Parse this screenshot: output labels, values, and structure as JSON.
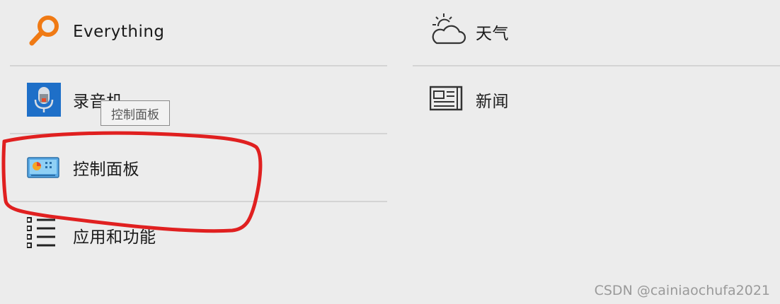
{
  "left_column": {
    "items": [
      {
        "label": "Everything",
        "icon": "everything-search-icon"
      },
      {
        "label": "录音机",
        "icon": "voice-recorder-icon"
      },
      {
        "label": "控制面板",
        "icon": "control-panel-icon"
      },
      {
        "label": "应用和功能",
        "icon": "apps-and-features-icon"
      }
    ]
  },
  "right_column": {
    "items": [
      {
        "label": "天气",
        "icon": "weather-icon"
      },
      {
        "label": "新闻",
        "icon": "news-icon"
      }
    ]
  },
  "tooltip": {
    "text": "控制面板"
  },
  "annotation": {
    "shape": "hand-drawn-circle",
    "color": "#e02020"
  },
  "watermark": {
    "text": "CSDN @cainiaochufa2021"
  },
  "colors": {
    "background": "#ececec",
    "divider": "#d4d4d4",
    "everything_orange": "#f07a14",
    "recorder_blue": "#1e6fc8",
    "annotation_red": "#e02020"
  }
}
